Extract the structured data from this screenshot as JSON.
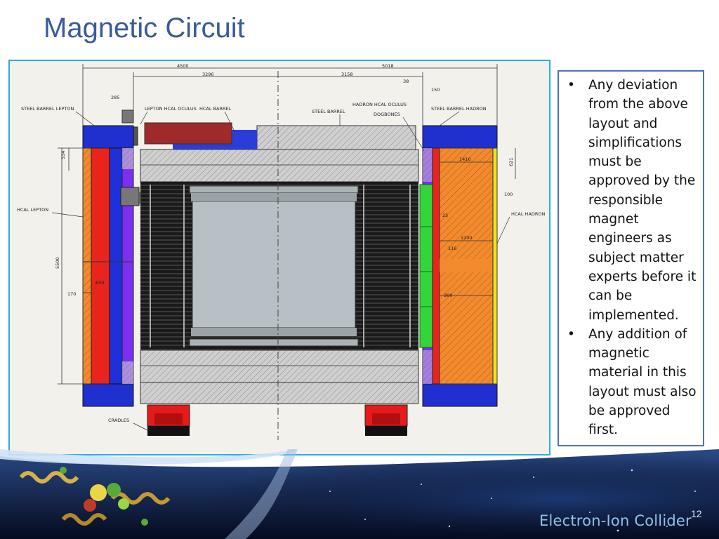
{
  "slide": {
    "title": "Magnetic Circuit",
    "page_number": "12",
    "brand": "Electron-Ion Collider"
  },
  "bullets": [
    "Any deviation from the above layout and simplifications must be approved by the responsible magnet engineers as subject matter experts before it can be implemented.",
    "Any addition of magnetic material in this layout must also be approved first."
  ],
  "drawing": {
    "labels": {
      "steel_barrel_lepton": "STEEL BARREL LEPTON",
      "lepton_hcal_oculus": "LEPTON HCAL OCULUS",
      "hcal_barrel": "HCAL BARREL",
      "steel_barrel": "STEEL BARREL",
      "hadron_hcal_oculus": "HADRON HCAL OCULUS",
      "dogbones": "DOGBONES",
      "steel_barrel_hadron": "STEEL BARREL HADRON",
      "hcal_lepton": "HCAL LEPTON",
      "hcal_hadron": "HCAL HADRON",
      "cradles": "CRADLES"
    },
    "dimensions": {
      "d4500": "4500",
      "d3296": "3296",
      "d5018": "5018",
      "d3158": "3158",
      "d38": "38",
      "d150": "150",
      "d285": "285",
      "d534": "534",
      "d5500": "5500",
      "d170": "170",
      "d630": "630",
      "d1416": "1416",
      "d621": "621",
      "d100": "100",
      "d25": "25",
      "d1200": "1200",
      "d116": "116",
      "d300": "300"
    }
  }
}
